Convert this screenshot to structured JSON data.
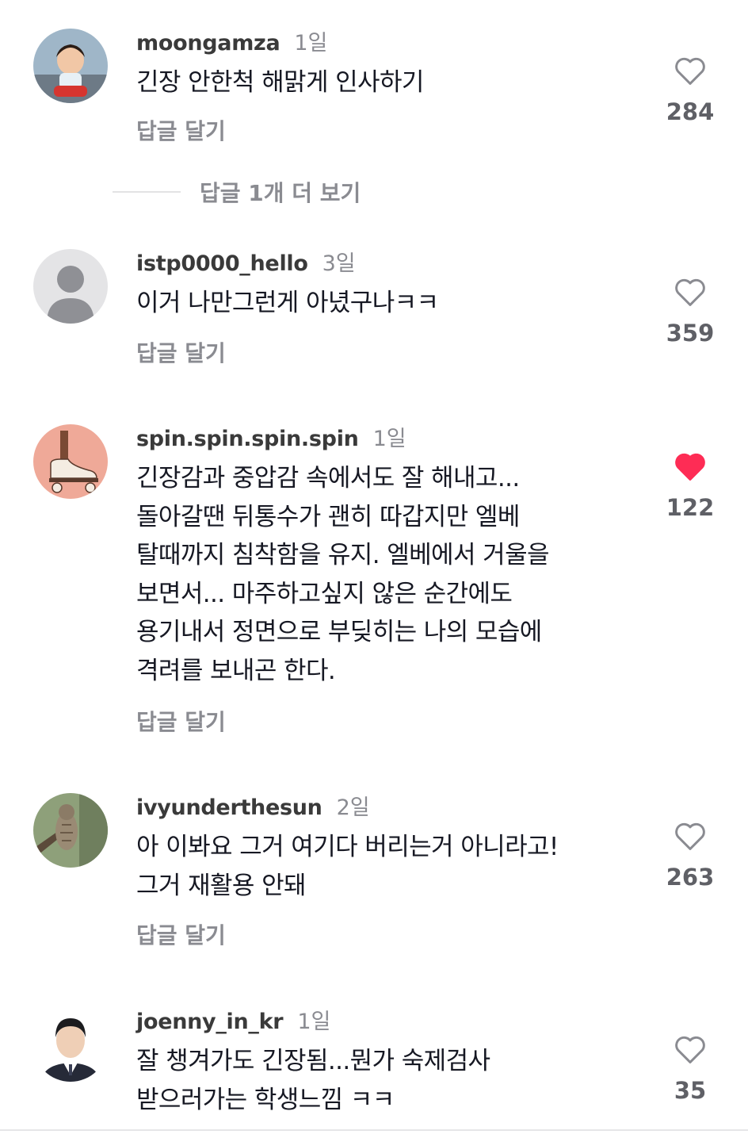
{
  "comments": [
    {
      "username": "moongamza",
      "time": "1일",
      "lines": [
        "긴장 안한척 해맑게 인사하기"
      ],
      "reply_label": "답글 달기",
      "likes": "284",
      "liked": false
    },
    {
      "username": "istp0000_hello",
      "time": "3일",
      "lines": [
        "이거 나만그런게 아녔구나ㅋㅋ"
      ],
      "reply_label": "답글 달기",
      "likes": "359",
      "liked": false
    },
    {
      "username": "spin.spin.spin.spin",
      "time": "1일",
      "lines": [
        "긴장감과 중압감 속에서도 잘 해내고...",
        "돌아갈땐 뒤통수가 괜히 따갑지만 엘베",
        "탈때까지 침착함을 유지. 엘베에서 거울을",
        "보면서... 마주하고싶지 않은 순간에도",
        "용기내서 정면으로 부딪히는 나의 모습에",
        "격려를 보내곤 한다."
      ],
      "reply_label": "답글 달기",
      "likes": "122",
      "liked": true
    },
    {
      "username": "ivyunderthesun",
      "time": "2일",
      "lines": [
        "아 이봐요 그거 여기다 버리는거 아니라고!",
        "그거 재활용 안돼"
      ],
      "reply_label": "답글 달기",
      "likes": "263",
      "liked": false
    },
    {
      "username": "joenny_in_kr",
      "time": "1일",
      "lines": [
        "잘 챙겨가도 긴장됨...뭔가 숙제검사",
        "받으러가는 학생느낌 ㅋㅋ"
      ],
      "likes": "35",
      "liked": false
    }
  ],
  "more_replies_label": "답글 1개 더 보기",
  "colors": {
    "liked_heart": "#fe2c55",
    "muted_text": "#8a8b91"
  },
  "icons": {
    "like": "heart-outline-icon",
    "liked": "heart-filled-icon"
  }
}
